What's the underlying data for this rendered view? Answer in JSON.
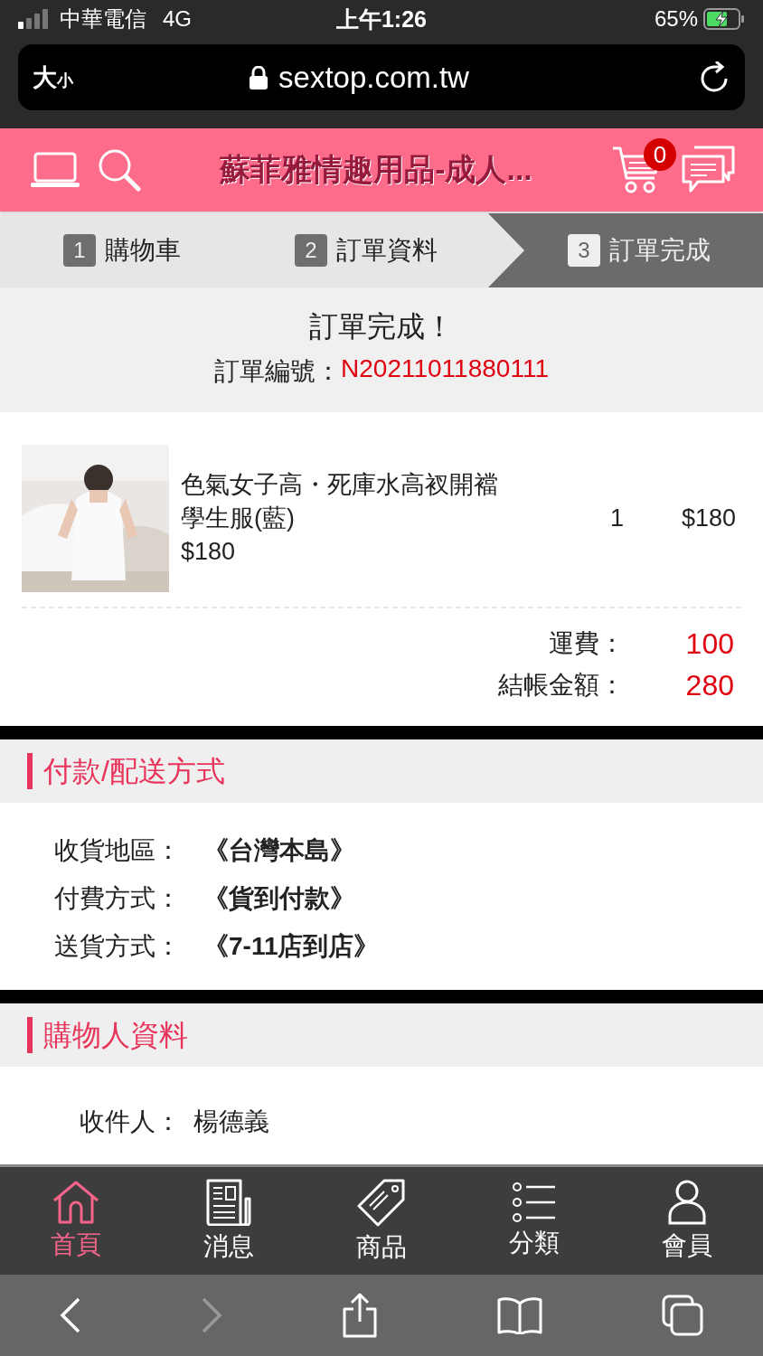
{
  "status_bar": {
    "carrier": "中華電信",
    "network": "4G",
    "time": "上午1:26",
    "battery": "65%"
  },
  "browser": {
    "text_size": {
      "large": "大",
      "small": "小"
    },
    "url": "sextop.com.tw"
  },
  "header": {
    "title": "蘇菲雅情趣用品-成人...",
    "cart_count": "0"
  },
  "steps": [
    {
      "number": "1",
      "label": "購物車",
      "selected": false
    },
    {
      "number": "2",
      "label": "訂單資料",
      "selected": false
    },
    {
      "number": "3",
      "label": "訂單完成",
      "selected": true
    }
  ],
  "order": {
    "heading": "訂單完成！",
    "number_label": "訂單編號：",
    "number": "N20211011880111"
  },
  "items": [
    {
      "name": "色氣女子高・死庫水高衩開襠學生服(藍)",
      "unit_price": "$180",
      "quantity": "1",
      "subtotal": "$180"
    }
  ],
  "totals": [
    {
      "label": "運費：",
      "value": "100"
    },
    {
      "label": "結帳金額：",
      "value": "280"
    }
  ],
  "sections": [
    {
      "kind": "payment",
      "title": "付款/配送方式",
      "rows": [
        {
          "label": "收貨地區：",
          "value": "《台灣本島》"
        },
        {
          "label": "付費方式：",
          "value": "《貨到付款》"
        },
        {
          "label": "送貨方式：",
          "value": "《7-11店到店》"
        }
      ]
    },
    {
      "kind": "buyer",
      "title": "購物人資料",
      "rows": [
        {
          "label": "收件人：",
          "value": "楊德義"
        }
      ]
    }
  ],
  "tab_bar": [
    {
      "label": "首頁",
      "selected": true
    },
    {
      "label": "消息",
      "selected": false
    },
    {
      "label": "商品",
      "selected": false
    },
    {
      "label": "分類",
      "selected": false
    },
    {
      "label": "會員",
      "selected": false
    }
  ],
  "toolbar": {
    "back": {
      "disabled": false
    },
    "forward": {
      "disabled": true
    }
  }
}
